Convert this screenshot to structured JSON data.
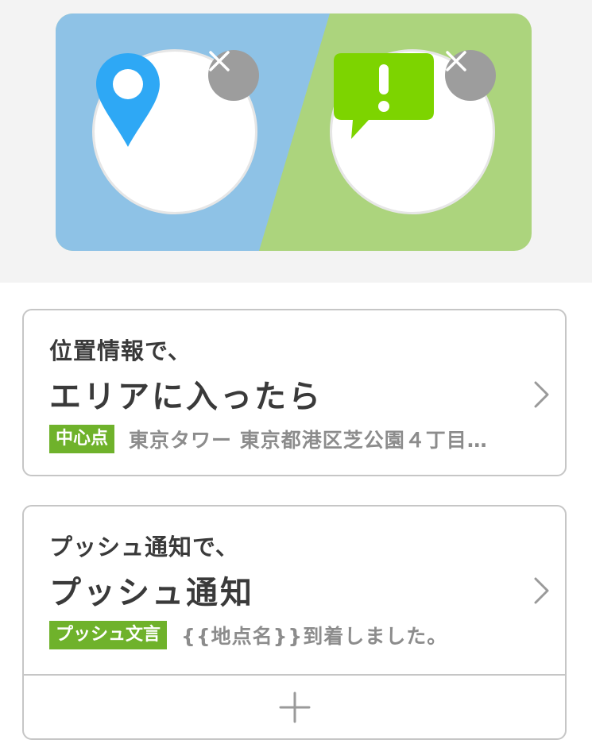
{
  "hero": {
    "colors": {
      "left_bg": "#8ec2e6",
      "right_bg": "#acd47d",
      "pin": "#2ea8f5",
      "bubble": "#7dd400",
      "remove_btn": "#9d9d9d"
    },
    "icons": [
      "location-pin-icon",
      "alert-message-icon",
      "close-icon"
    ]
  },
  "trigger_card": {
    "lead": "位置情報で、",
    "title": "エリアに入ったら",
    "tag": "中心点",
    "value": "東京タワー 東京都港区芝公園４丁目…",
    "tag_color": "#6fb22b"
  },
  "action_card": {
    "lead": "プッシュ通知で、",
    "title": "プッシュ通知",
    "tag": "プッシュ文言",
    "value": "{{地点名}}到着しました。",
    "tag_color": "#6fb22b"
  }
}
